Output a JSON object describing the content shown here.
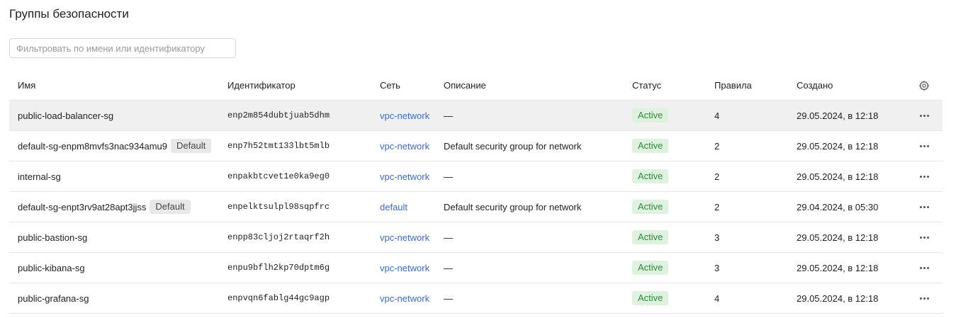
{
  "page": {
    "title": "Группы безопасности",
    "filter_placeholder": "Фильтровать по имени или идентификатору"
  },
  "table": {
    "columns": {
      "name": "Имя",
      "id": "Идентификатор",
      "network": "Сеть",
      "description": "Описание",
      "status": "Статус",
      "rules": "Правила",
      "created": "Создано"
    },
    "rows": [
      {
        "name": "public-load-balancer-sg",
        "badge": "",
        "id": "enp2m854dubtjuab5dhm",
        "network": "vpc-network",
        "description": "—",
        "status": "Active",
        "rules": "4",
        "created": "29.05.2024, в 12:18"
      },
      {
        "name": "default-sg-enpm8mvfs3nac934amu9",
        "badge": "Default",
        "id": "enp7h52tmt133lbt5mlb",
        "network": "vpc-network",
        "description": "Default security group for network",
        "status": "Active",
        "rules": "2",
        "created": "29.05.2024, в 12:18"
      },
      {
        "name": "internal-sg",
        "badge": "",
        "id": "enpakbtcvet1e0ka9eg0",
        "network": "vpc-network",
        "description": "—",
        "status": "Active",
        "rules": "2",
        "created": "29.05.2024, в 12:18"
      },
      {
        "name": "default-sg-enpt3rv9at28apt3jjss",
        "badge": "Default",
        "id": "enpelktsulpl98sqpfrc",
        "network": "default",
        "description": "Default security group for network",
        "status": "Active",
        "rules": "2",
        "created": "29.04.2024, в 05:30"
      },
      {
        "name": "public-bastion-sg",
        "badge": "",
        "id": "enpp83cljoj2rtaqrf2h",
        "network": "vpc-network",
        "description": "—",
        "status": "Active",
        "rules": "3",
        "created": "29.05.2024, в 12:18"
      },
      {
        "name": "public-kibana-sg",
        "badge": "",
        "id": "enpu9bflh2kp70dptm6g",
        "network": "vpc-network",
        "description": "—",
        "status": "Active",
        "rules": "3",
        "created": "29.05.2024, в 12:18"
      },
      {
        "name": "public-grafana-sg",
        "badge": "",
        "id": "enpvqn6fablg44gc9agp",
        "network": "vpc-network",
        "description": "—",
        "status": "Active",
        "rules": "4",
        "created": "29.05.2024, в 12:18"
      }
    ]
  },
  "icons": {
    "settings": "gear-icon",
    "row_actions": "more-horizontal-icon"
  },
  "colors": {
    "link": "#3a6ad0",
    "status_active_bg": "#dff2e0",
    "status_active_text": "#2f8a3a",
    "hover_row_bg": "#f0f0f0"
  }
}
